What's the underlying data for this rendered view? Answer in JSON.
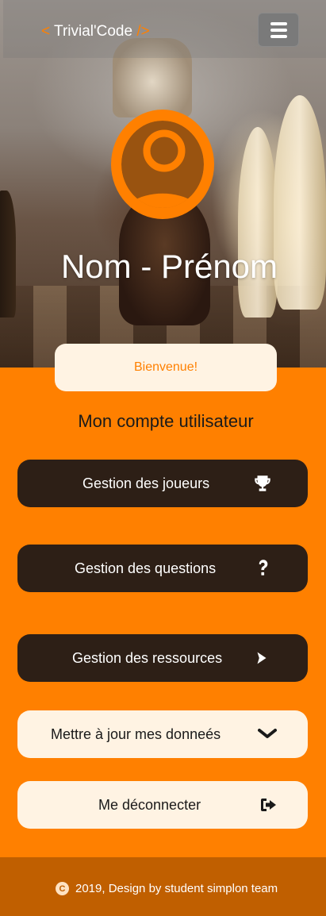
{
  "navbar": {
    "brand_open": "<",
    "brand_name": "Trivial'Code",
    "brand_close": "/>",
    "menu_icon": "hamburger-icon"
  },
  "profile": {
    "name": "Nom - Prénom",
    "avatar_icon": "user-circle-icon"
  },
  "welcome": "Bienvenue!",
  "section_title": "Mon compte utilisateur",
  "actions": [
    {
      "label": "Gestion des joueurs",
      "icon": "trophy-icon",
      "style": "dark"
    },
    {
      "label": "Gestion des questions",
      "icon": "question-icon",
      "style": "dark"
    },
    {
      "label": "Gestion des ressources",
      "icon": "chevron-right-icon",
      "style": "dark"
    },
    {
      "label": "Mettre à jour mes donneés",
      "icon": "chevron-down-icon",
      "style": "light"
    },
    {
      "label": "Me déconnecter",
      "icon": "sign-out-icon",
      "style": "light"
    }
  ],
  "footer": {
    "copyright_icon": "copyright-icon",
    "text": "2019, Design by student simplon team"
  },
  "colors": {
    "accent": "#ff8000",
    "dark_button": "#2d1f16",
    "light_button": "#fff3e3",
    "footer": "#c05f00"
  }
}
